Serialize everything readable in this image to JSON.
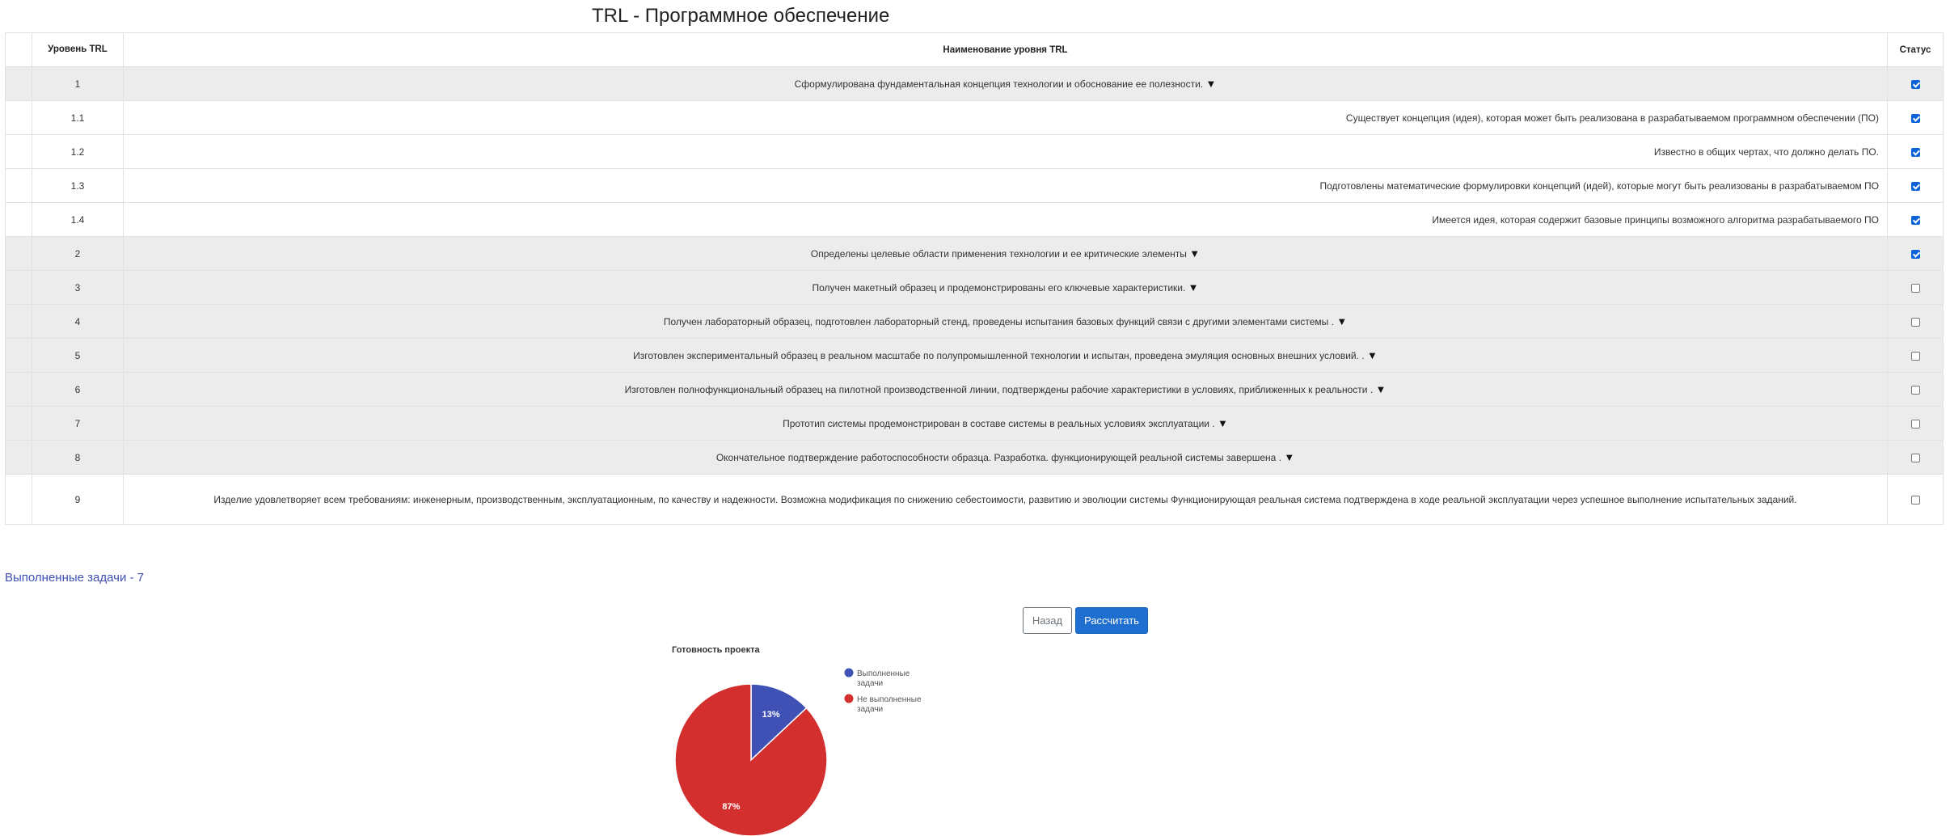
{
  "title": "TRL - Программное обеспечение",
  "table": {
    "headers": {
      "level": "Уровень TRL",
      "name": "Наименование уровня TRL",
      "status": "Статус"
    },
    "rows": [
      {
        "level": "1",
        "name": "Сформулирована фундаментальная концепция технологии и обоснование ее полезности.",
        "arrow": "▼",
        "checked": true,
        "style": "gray"
      },
      {
        "level": "1.1",
        "name": "Существует концепция (идея), которая может быть реализована в разрабатываемом программном обеспечении (ПО)",
        "checked": true,
        "style": "sub"
      },
      {
        "level": "1.2",
        "name": "Известно в общих чертах, что должно делать ПО.",
        "checked": true,
        "style": "sub"
      },
      {
        "level": "1.3",
        "name": "Подготовлены математические формулировки концепций (идей), которые могут быть реализованы в разрабатываемом ПО",
        "checked": true,
        "style": "sub"
      },
      {
        "level": "1.4",
        "name": "Имеется идея, которая содержит базовые принципы возможного алгоритма разрабатываемого ПО",
        "checked": true,
        "style": "sub"
      },
      {
        "level": "2",
        "name": "Определены целевые области применения технологии и ее критические элементы",
        "arrow": "▼",
        "checked": true,
        "style": "gray"
      },
      {
        "level": "3",
        "name": "Получен макетный образец и продемонстрированы его ключевые характеристики.",
        "arrow": "▼",
        "checked": false,
        "style": "gray"
      },
      {
        "level": "4",
        "name": "Получен лабораторный образец, подготовлен лабораторный стенд, проведены испытания базовых функций связи с другими элементами системы .",
        "arrow": "▼",
        "checked": false,
        "style": "gray"
      },
      {
        "level": "5",
        "name": "Изготовлен экспериментальный образец в реальном масштабе по полупромышленной технологии и испытан, проведена эмуляция основных внешних условий. .",
        "arrow": "▼",
        "checked": false,
        "style": "gray"
      },
      {
        "level": "6",
        "name": "Изготовлен полнофункциональный образец на пилотной производственной линии, подтверждены рабочие характеристики в условиях, приближенных к реальности .",
        "arrow": "▼",
        "checked": false,
        "style": "gray"
      },
      {
        "level": "7",
        "name": "Прототип системы продемонстрирован в составе системы в реальных условиях эксплуатации .",
        "arrow": "▼",
        "checked": false,
        "style": "gray"
      },
      {
        "level": "8",
        "name": "Окончательное подтверждение работоспособности образца. Разработка. функционирующей реальной системы завершена .",
        "arrow": "▼",
        "checked": false,
        "style": "gray"
      },
      {
        "level": "9",
        "name": "Изделие удовлетворяет всем требованиям: инженерным, производственным, эксплуатационным, по качеству и надежности. Возможна модификация по снижению себестоимости, развитию и эволюции системы Функционирующая реальная система подтверждена в ходе реальной эксплуатации через успешное выполнение испытательных заданий.",
        "checked": false,
        "style": "white"
      }
    ]
  },
  "completed_tasks": "Выполненные задачи - 7",
  "buttons": {
    "back": "Назад",
    "calculate": "Рассчитать"
  },
  "colors": {
    "completed": "#3f51b5",
    "not_completed": "#d32f2f",
    "checkbox": "#0a64d8"
  },
  "chart_data": {
    "type": "pie",
    "title": "Готовность проекта",
    "series": [
      {
        "name": "Выполненные задачи",
        "value": 13,
        "label": "13%"
      },
      {
        "name": "Не выполненные задачи",
        "value": 87,
        "label": "87%"
      }
    ],
    "legend": [
      {
        "lines": [
          "Выполненные",
          "задачи"
        ]
      },
      {
        "lines": [
          "Не выполненные",
          "задачи"
        ]
      }
    ],
    "legend_position": "right"
  }
}
